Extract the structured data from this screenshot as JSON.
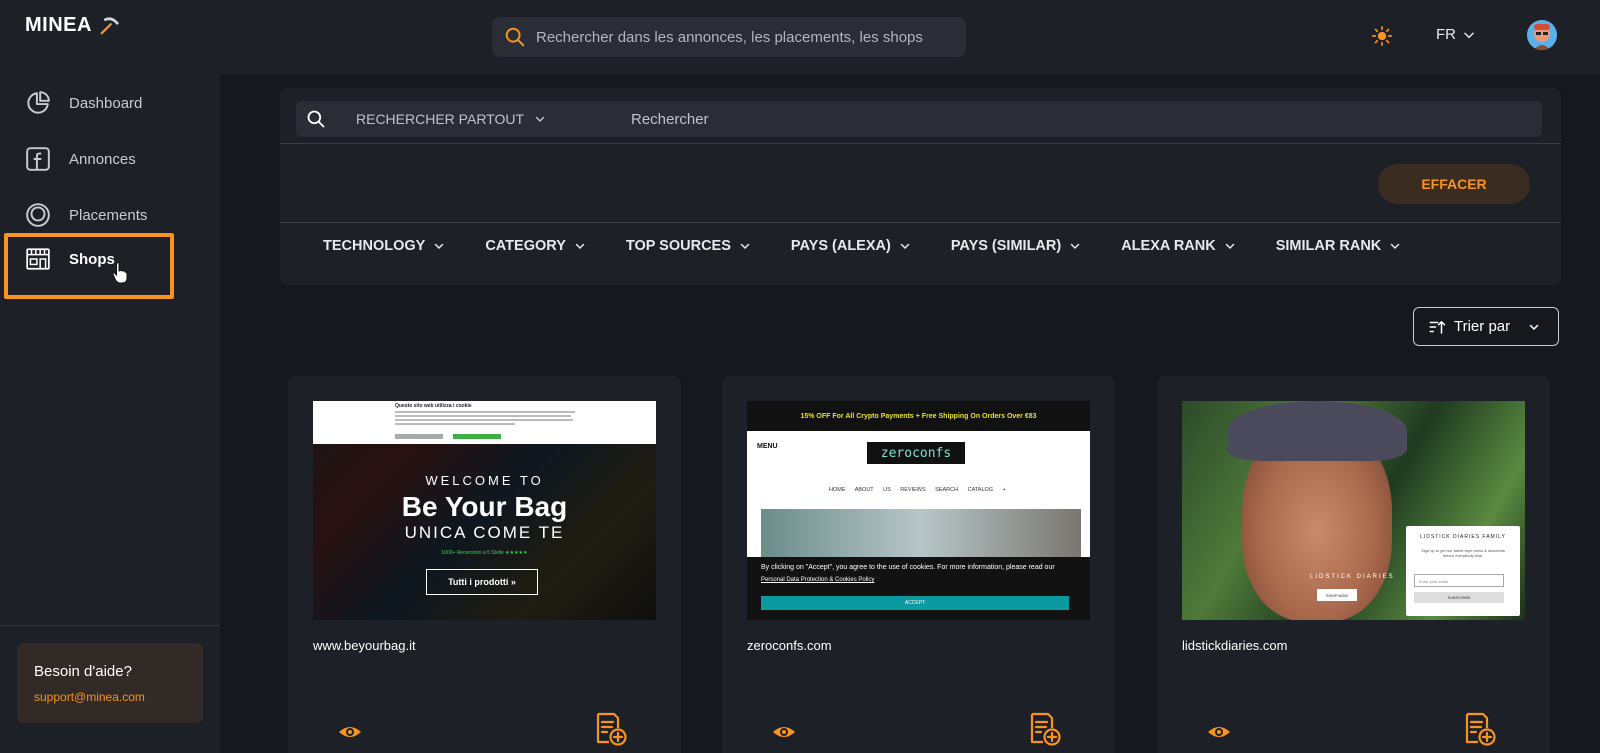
{
  "app": {
    "name": "MINEA"
  },
  "header": {
    "search_placeholder": "Rechercher dans les annonces, les placements, les shops",
    "language": "FR"
  },
  "sidebar": {
    "items": [
      {
        "label": "Dashboard",
        "icon": "pie-chart-icon"
      },
      {
        "label": "Annonces",
        "icon": "facebook-icon"
      },
      {
        "label": "Placements",
        "icon": "instagram-icon"
      },
      {
        "label": "Shops",
        "icon": "store-icon",
        "active": true
      }
    ],
    "help": {
      "title": "Besoin d'aide?",
      "email": "support@minea.com"
    }
  },
  "filters_panel": {
    "scope": "RECHERCHER PARTOUT",
    "search_placeholder": "Rechercher",
    "clear_label": "EFFACER",
    "filters": [
      "TECHNOLOGY",
      "CATEGORY",
      "TOP SOURCES",
      "PAYS (ALEXA)",
      "PAYS (SIMILAR)",
      "ALEXA RANK",
      "SIMILAR RANK"
    ]
  },
  "sort": {
    "label": "Trier par"
  },
  "colors": {
    "accent": "#f7931e",
    "bg": "#16181d",
    "panel": "#1e2027"
  },
  "shops": [
    {
      "domain": "www.beyourbag.it",
      "preview": {
        "cookie_title": "Questo sito web utilizza i cookie",
        "welcome": "WELCOME TO",
        "title": "Be Your Bag",
        "subtitle": "UNICA COME TE",
        "rating": "1000+ Recensioni a 5 Stelle ★★★★★",
        "cta": "Tutti i prodotti »"
      }
    },
    {
      "domain": "zeroconfs.com",
      "preview": {
        "promo": "15% OFF For All Crypto Payments + Free Shipping On Orders Over €83",
        "menu": "MENU",
        "logo": "zeroconfs",
        "nav": "HOME ABOUT US REVIEWS SEARCH CATALOG +",
        "cookie_text": "By clicking on \"Accept\", you agree to the use of cookies. For more information, please read our",
        "cookie_link": "Personal Data Protection & Cookies Policy",
        "accept": "ACCEPT"
      }
    },
    {
      "domain": "lidstickdiaries.com",
      "preview": {
        "popup_title": "LIDSTICK DIARIES FAMILY",
        "popup_text": "Sign up to get our latest style news & discounts before everybody else.",
        "email_placeholder": "Enter your email",
        "subscribe": "SUBSCRIBE",
        "brand": "LIDSTICK DIARIES",
        "shop_now": "SHOP NOW"
      }
    }
  ]
}
